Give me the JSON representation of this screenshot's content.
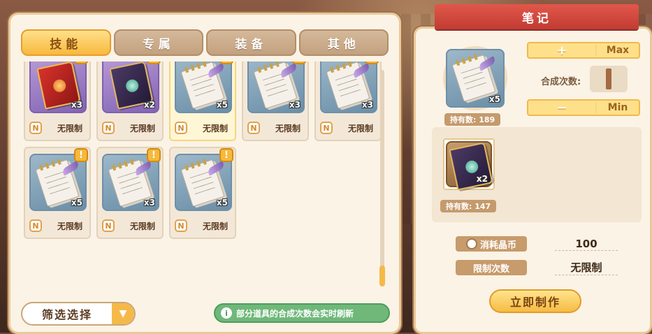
{
  "tabs": [
    {
      "label": "技能",
      "active": true
    },
    {
      "label": "专属",
      "active": false
    },
    {
      "label": "装备",
      "active": false
    },
    {
      "label": "其他",
      "active": false
    }
  ],
  "badge_letter": "N",
  "limit_text": "无限制",
  "alert_mark": "!",
  "ghost_row": [
    {
      "badge": "N",
      "limit": "无限制"
    },
    {
      "badge": "N",
      "limit": "无限制"
    },
    {
      "badge": "N",
      "limit": "无限制"
    },
    {
      "badge": "N",
      "limit": "无限制"
    },
    {
      "badge": "N",
      "limit": "无限制"
    }
  ],
  "items": [
    {
      "art": "red-book",
      "frame": "purple",
      "count": "x3",
      "badge": "N",
      "limit": "无限制",
      "selected": false
    },
    {
      "art": "dark-book",
      "frame": "purple",
      "count": "x2",
      "badge": "N",
      "limit": "无限制",
      "selected": false
    },
    {
      "art": "note",
      "frame": "blue",
      "count": "x5",
      "badge": "N",
      "limit": "无限制",
      "selected": true
    },
    {
      "art": "note",
      "frame": "blue",
      "count": "x3",
      "badge": "N",
      "limit": "无限制",
      "selected": false
    },
    {
      "art": "note",
      "frame": "blue",
      "count": "x3",
      "badge": "N",
      "limit": "无限制",
      "selected": false
    },
    {
      "art": "note",
      "frame": "blue",
      "count": "x5",
      "badge": "N",
      "limit": "无限制",
      "selected": false
    },
    {
      "art": "note",
      "frame": "blue",
      "count": "x3",
      "badge": "N",
      "limit": "无限制",
      "selected": false
    },
    {
      "art": "note",
      "frame": "blue",
      "count": "x5",
      "badge": "N",
      "limit": "无限制",
      "selected": false
    }
  ],
  "filter": {
    "label": "筛选选择"
  },
  "notice": {
    "text": "部分道具的合成次数会实时刷新"
  },
  "detail": {
    "title": "笔记",
    "item_count": "x5",
    "owned_label": "持有数: 189",
    "max_sign": "+",
    "max_label": "Max",
    "min_sign": "−",
    "min_label": "Min",
    "synth_label": "合成次数:",
    "material": {
      "count": "x2",
      "owned_label": "持有数: 147"
    },
    "cost_label": "消耗晶币",
    "cost_value": "100",
    "limit_label": "限制次数",
    "limit_value": "无限制",
    "craft_button": "立即制作"
  },
  "colors": {
    "accent": "#f6b93b",
    "banner": "#c13b33",
    "notice": "#6fb87a"
  }
}
